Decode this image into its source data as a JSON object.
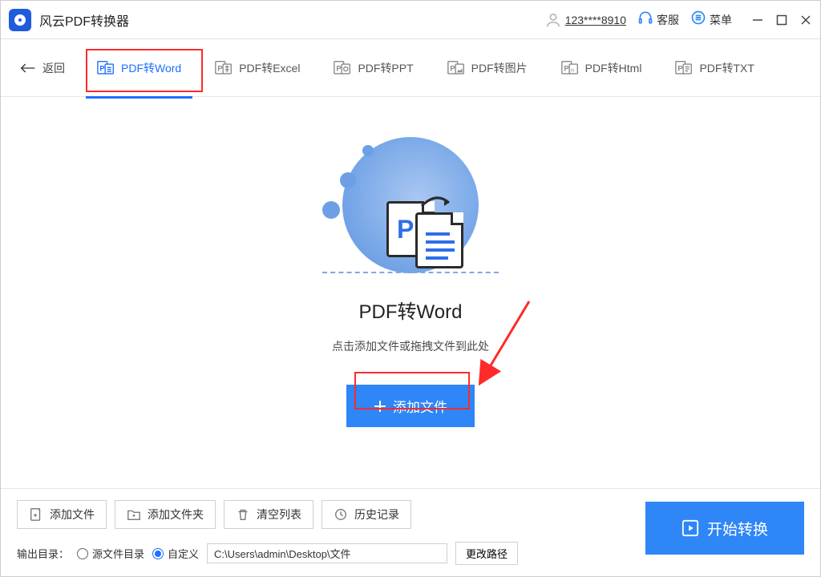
{
  "app": {
    "title": "风云PDF转换器"
  },
  "titlebar": {
    "user": "123****8910",
    "support": "客服",
    "menu": "菜单"
  },
  "tabs": {
    "back": "返回",
    "items": [
      {
        "label": "PDF转Word"
      },
      {
        "label": "PDF转Excel"
      },
      {
        "label": "PDF转PPT"
      },
      {
        "label": "PDF转图片"
      },
      {
        "label": "PDF转Html"
      },
      {
        "label": "PDF转TXT"
      }
    ]
  },
  "main": {
    "title": "PDF转Word",
    "subtitle": "点击添加文件或拖拽文件到此处",
    "add_button": "添加文件"
  },
  "bottom": {
    "add_file": "添加文件",
    "add_folder": "添加文件夹",
    "clear_list": "清空列表",
    "history": "历史记录",
    "out_label": "输出目录：",
    "radio_source": "源文件目录",
    "radio_custom": "自定义",
    "path_value": "C:\\Users\\admin\\Desktop\\文件",
    "change_path": "更改路径",
    "start": "开始转换"
  }
}
